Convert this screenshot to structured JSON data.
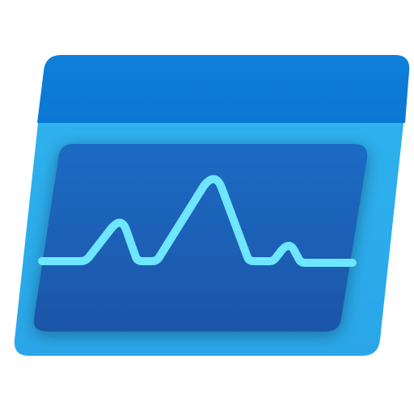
{
  "icon": {
    "name": "monitoring-chart-icon",
    "colors": {
      "header": "#0b78d4",
      "body": "#2fb4ef",
      "screen_top": "#1e6bc4",
      "screen_bottom": "#1a55a8",
      "pulse_line": "#6fe6ff"
    }
  }
}
